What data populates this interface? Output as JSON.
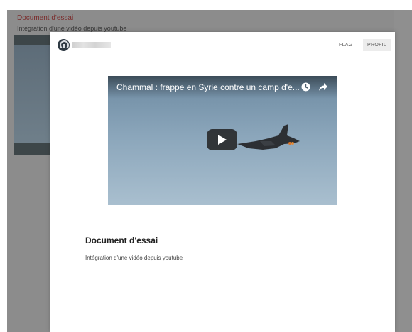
{
  "background": {
    "title": "Document d'essai",
    "subtitle": "Intégration d'une vidéo depuis youtube"
  },
  "modal": {
    "username": "",
    "flag_label": "FLAG",
    "profil_label": "PROFIL",
    "video": {
      "title": "Chammal : frappe en Syrie contre un camp d'e..."
    },
    "document_title": "Document d'essai",
    "document_description": "Intégration d'une vidéo depuis youtube"
  },
  "icons": [
    "avatar-icon",
    "clock-icon",
    "share-icon",
    "play-icon"
  ],
  "colors": {
    "overlay": "#8c8c8c",
    "background_title": "#7a2b2b",
    "modal_bg": "#ffffff",
    "profil_button_bg": "#ececec"
  }
}
